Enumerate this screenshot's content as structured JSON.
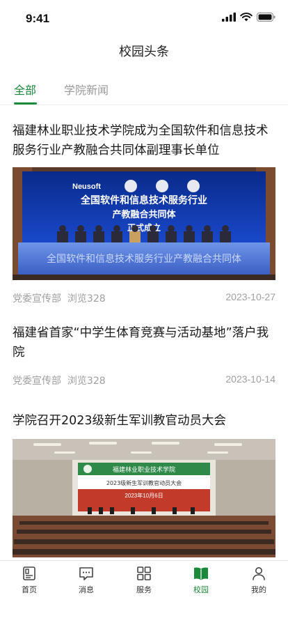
{
  "status": {
    "time": "9:41"
  },
  "nav": {
    "title": "校园头条"
  },
  "tabs": [
    {
      "label": "全部",
      "active": true
    },
    {
      "label": "学院新闻",
      "active": false
    }
  ],
  "articles": [
    {
      "title": "福建林业职业技术学院成为全国软件和信息技术服务行业产教融合共同体副理事长单位",
      "source": "党委宣传部",
      "views": "浏览328",
      "date": "2023-10-27",
      "image": {
        "logo": "Neusoft",
        "banner_line1": "全国软件和信息技术服务行业",
        "banner_line2": "产教融合共同体",
        "banner_line3": "正式成立",
        "podium_text": "全国软件和信息技术服务行业产教融合共同体"
      }
    },
    {
      "title": "福建省首家“中学生体育竞赛与活动基地”落户我院",
      "source": "党委宣传部",
      "views": "浏览328",
      "date": "2023-10-14"
    },
    {
      "title": "学院召开2023级新生军训教官动员大会",
      "image": {
        "school_name": "福建林业职业技术学院",
        "screen_title": "2023级新生军训教官动员大会",
        "screen_date": "2023年10月6日"
      }
    }
  ],
  "tabbar": [
    {
      "label": "首页",
      "icon": "home-doc-icon",
      "active": false
    },
    {
      "label": "消息",
      "icon": "message-icon",
      "active": false
    },
    {
      "label": "服务",
      "icon": "grid-icon",
      "active": false
    },
    {
      "label": "校园",
      "icon": "book-icon",
      "active": true
    },
    {
      "label": "我的",
      "icon": "person-icon",
      "active": false
    }
  ],
  "colors": {
    "accent": "#1a8a3a",
    "muted": "#a0a0a0"
  }
}
